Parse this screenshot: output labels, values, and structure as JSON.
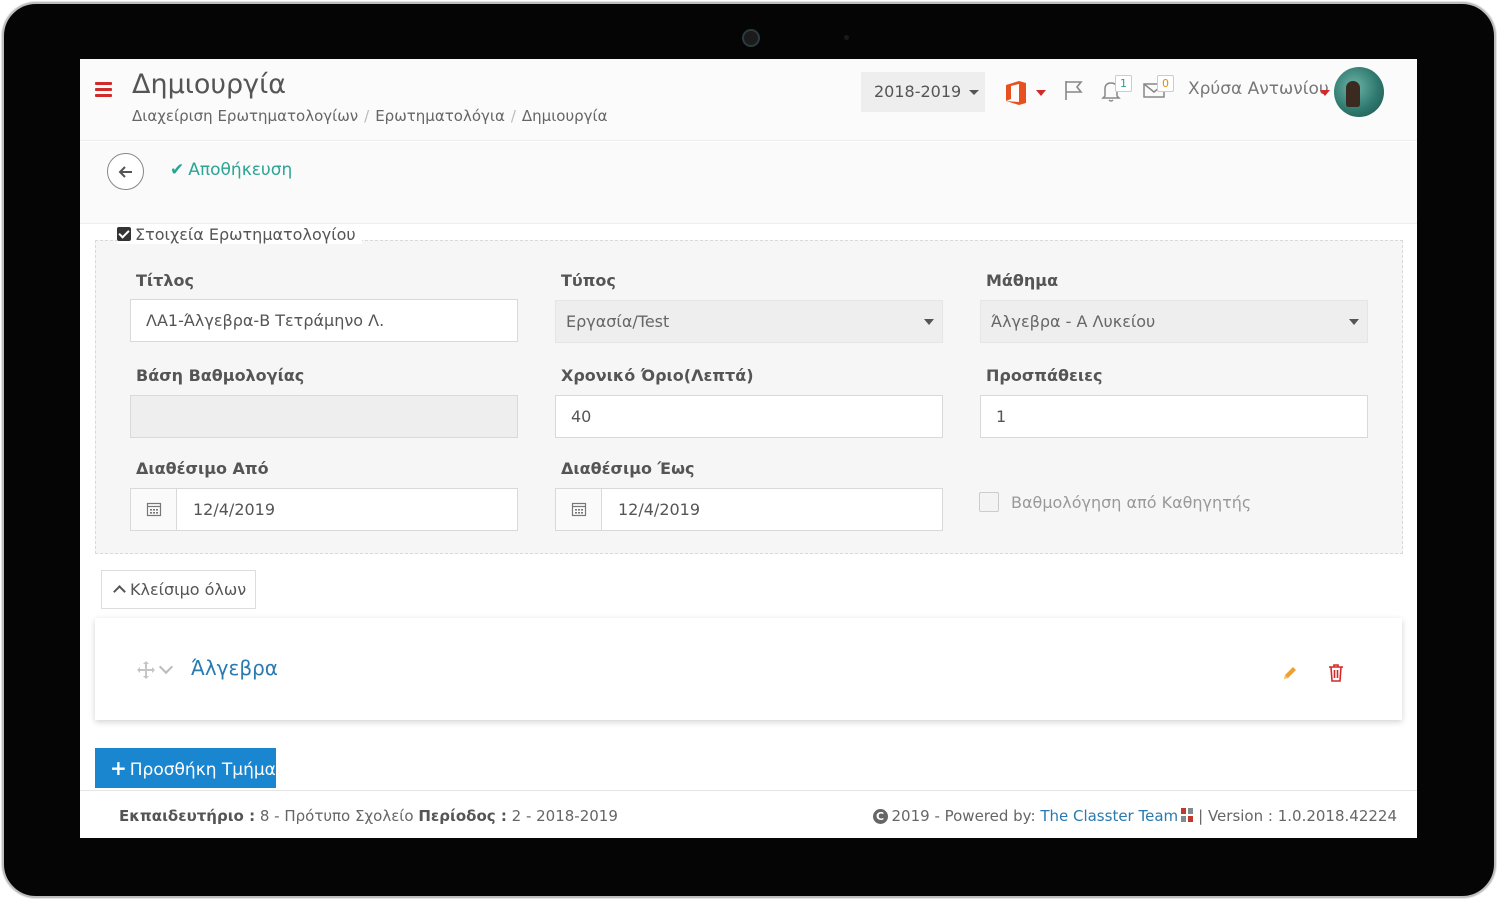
{
  "header": {
    "title": "Δημιουργία",
    "breadcrumb": [
      "Διαχείριση Ερωτηματολογίων",
      "Ερωτηματολόγια",
      "Δημιουργία"
    ],
    "year": "2018-2019",
    "notifications_count": "1",
    "messages_count": "0",
    "user_name": "Χρύσα Αντωνίου"
  },
  "toolbar": {
    "save_label": "Αποθήκευση"
  },
  "form": {
    "legend": "Στοιχεία Ερωτηματολογίου",
    "title_label": "Τίτλος",
    "title_value": "ΛΑ1-Άλγεβρα-Β Τετράμηνο Λ.",
    "type_label": "Τύπος",
    "type_value": "Εργασία/Test",
    "course_label": "Μάθημα",
    "course_value": "Άλγεβρα - Α Λυκείου",
    "grade_base_label": "Βάση Βαθμολογίας",
    "grade_base_value": "",
    "time_limit_label": "Χρονικό Όριο(Λεπτά)",
    "time_limit_value": "40",
    "attempts_label": "Προσπάθειες",
    "attempts_value": "1",
    "available_from_label": "Διαθέσιμο Από",
    "available_from_value": "12/4/2019",
    "available_to_label": "Διαθέσιμο Έως",
    "available_to_value": "12/4/2019",
    "teacher_grading_label": "Βαθμολόγηση από Καθηγητής",
    "teacher_grading_checked": false
  },
  "sections": {
    "collapse_all_label": "Κλείσιμο όλων",
    "items": [
      {
        "title": "Άλγεβρα"
      }
    ],
    "add_section_label": "Προσθήκη Τμήμα"
  },
  "footer": {
    "school_label": "Εκπαιδευτήριο :",
    "school_value": "8 - Πρότυπο Σχολείο",
    "period_label": "Περίοδος :",
    "period_value": "2 - 2018-2019",
    "powered_prefix": "2019 - Powered by:",
    "powered_team": "The Classter Team",
    "version": "| Version : 1.0.2018.42224"
  },
  "colors": {
    "accent_red": "#d12a2a",
    "save_green": "#2aa493",
    "link_blue": "#2a7ab0",
    "primary_button": "#1a86cf",
    "edit_orange": "#f0a030"
  }
}
